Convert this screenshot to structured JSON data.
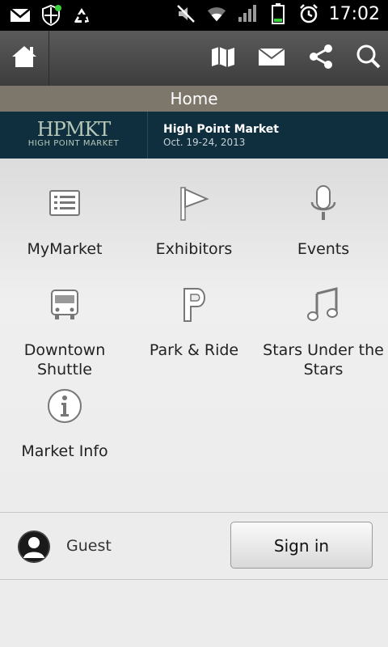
{
  "status_bar": {
    "time": "17:02",
    "left_icons": [
      "gmail-icon",
      "shield-icon",
      "recycle-icon"
    ],
    "right_icons": [
      "mute-icon",
      "wifi-icon",
      "signal-icon",
      "battery-icon",
      "alarm-icon"
    ]
  },
  "app_bar": {
    "icons": [
      "home-icon",
      "map-icon",
      "mail-icon",
      "share-icon",
      "search-icon"
    ]
  },
  "title": "Home",
  "banner": {
    "logo_text": "HPMKT",
    "logo_sub": "HIGH POINT MARKET",
    "event_name": "High Point Market",
    "event_dates": "Oct. 19-24, 2013"
  },
  "menu": {
    "items": [
      {
        "label": "MyMarket",
        "icon": "list-icon"
      },
      {
        "label": "Exhibitors",
        "icon": "flag-icon"
      },
      {
        "label": "Events",
        "icon": "microphone-icon"
      },
      {
        "label": "Downtown Shuttle",
        "icon": "bus-icon"
      },
      {
        "label": "Park & Ride",
        "icon": "parking-icon"
      },
      {
        "label": "Stars Under the Stars",
        "icon": "music-note-icon"
      },
      {
        "label": "Market Info",
        "icon": "info-icon"
      }
    ]
  },
  "user": {
    "name": "Guest",
    "sign_in_label": "Sign in"
  },
  "colors": {
    "status_bg": "#000000",
    "appbar_bg": "#4a4a4a",
    "titlebar_bg": "#7d776b",
    "banner_bg": "#0f2f3f",
    "page_bg": "#ececec"
  }
}
